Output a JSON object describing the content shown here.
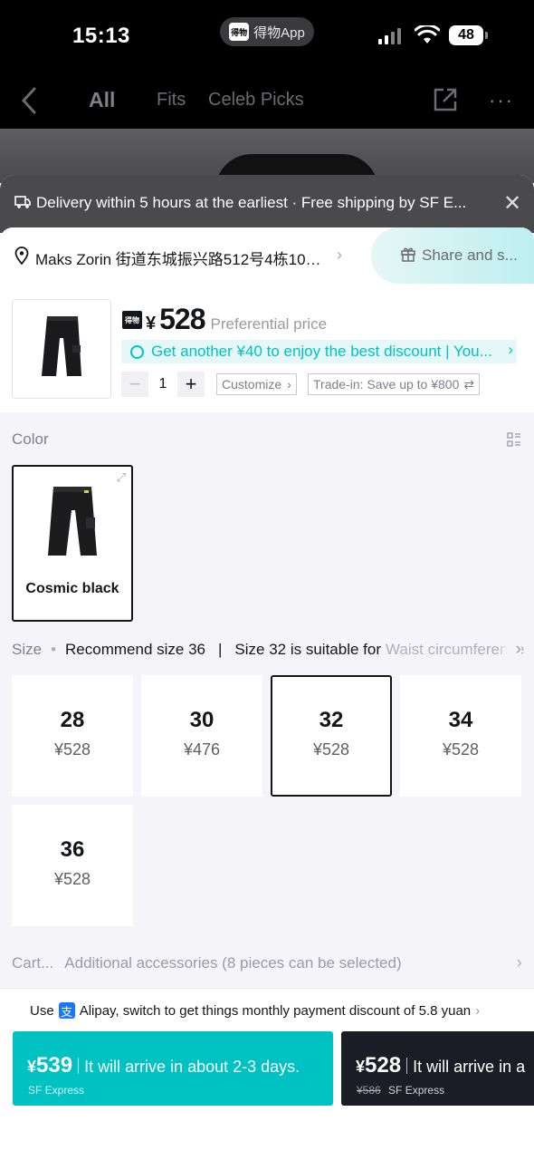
{
  "status_bar": {
    "time": "15:13",
    "app_pill": "得物App",
    "app_logo": "得物",
    "battery": "48"
  },
  "nav": {
    "tabs": [
      {
        "label": "All"
      },
      {
        "label": "Fits"
      },
      {
        "label": "Celeb Picks"
      }
    ]
  },
  "delivery_banner": {
    "text": "Delivery within 5 hours at the earliest · Free shipping by SF E..."
  },
  "address": {
    "text": "Maks Zorin 街道东城振兴路512号4栋101...",
    "share_label": "Share and s..."
  },
  "product": {
    "brand_mark": "得物",
    "currency": "¥",
    "price": "528",
    "price_note": "Preferential price",
    "promo": "Get another ¥40 to enjoy the best discount | You...",
    "quantity": "1",
    "customize": "Customize",
    "trade_in": "Trade-in: Save up to ¥800"
  },
  "color_section": {
    "label": "Color",
    "options": [
      {
        "name": "Cosmic black",
        "selected": true
      }
    ]
  },
  "size_section": {
    "label": "Size",
    "recommend": "Recommend size 36",
    "fit_note": "Size 32 is suitable for",
    "fit_detail": "Waist circumference",
    "sizes": [
      {
        "size": "28",
        "price": "¥528",
        "selected": false
      },
      {
        "size": "30",
        "price": "¥476",
        "selected": false
      },
      {
        "size": "32",
        "price": "¥528",
        "selected": true
      },
      {
        "size": "34",
        "price": "¥528",
        "selected": false
      },
      {
        "size": "36",
        "price": "¥528",
        "selected": false
      }
    ]
  },
  "accessories": {
    "label": "Cart...",
    "text": "Additional accessories (8 pieces can be selected)"
  },
  "payment_note": {
    "prefix": "Use",
    "icon_glyph": "支",
    "text": "Alipay, switch to get things monthly payment discount of 5.8 yuan"
  },
  "buy_options": [
    {
      "currency": "¥",
      "price": "539",
      "message": "It will arrive in about 2-3 days.",
      "original": "",
      "carrier": "SF Express",
      "color": "#01c2c3"
    },
    {
      "currency": "¥",
      "price": "528",
      "message": "It will arrive in a",
      "original": "¥586",
      "carrier": "SF Express",
      "color": "#1c1c26"
    }
  ],
  "colors": {
    "accent": "#01c2c3",
    "dark": "#14151a"
  }
}
